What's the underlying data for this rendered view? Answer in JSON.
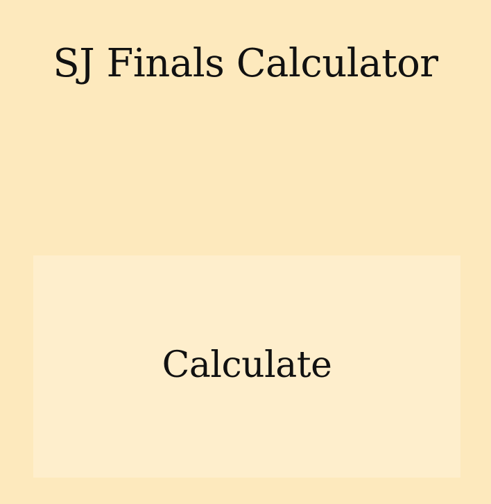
{
  "app": {
    "title": "SJ Finals Calculator"
  },
  "main": {
    "calculate_label": "Calculate"
  },
  "colors": {
    "background": "#fde9bd",
    "button_background": "#feeecc",
    "text": "#111111"
  }
}
